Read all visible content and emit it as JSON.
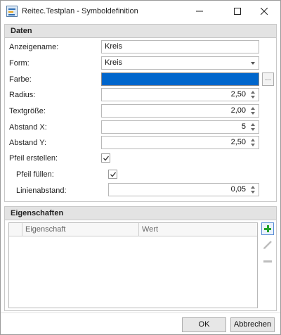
{
  "window": {
    "title": "Reitec.Testplan - Symboldefinition",
    "minimize_glyph": "—",
    "maximize_glyph": "☐",
    "close_glyph": "✕"
  },
  "daten": {
    "header": "Daten",
    "anzeigename": {
      "label": "Anzeigename:",
      "value": "Kreis"
    },
    "form": {
      "label": "Form:",
      "value": "Kreis"
    },
    "farbe": {
      "label": "Farbe:",
      "color": "#0066cc",
      "button_label": "..."
    },
    "radius": {
      "label": "Radius:",
      "value": "2,50"
    },
    "textgroesse": {
      "label": "Textgröße:",
      "value": "2,00"
    },
    "abstand_x": {
      "label": "Abstand X:",
      "value": "5"
    },
    "abstand_y": {
      "label": "Abstand Y:",
      "value": "2,50"
    },
    "pfeil_erstellen": {
      "label": "Pfeil erstellen:",
      "checked": true
    },
    "pfeil_fuellen": {
      "label": "Pfeil füllen:",
      "checked": true
    },
    "linienabstand": {
      "label": "Linienabstand:",
      "value": "0,05"
    }
  },
  "eigenschaften": {
    "header": "Eigenschaften",
    "columns": [
      "Eigenschaft",
      "Wert"
    ],
    "rows": []
  },
  "footer": {
    "ok_label": "OK",
    "cancel_label": "Abbrechen"
  }
}
